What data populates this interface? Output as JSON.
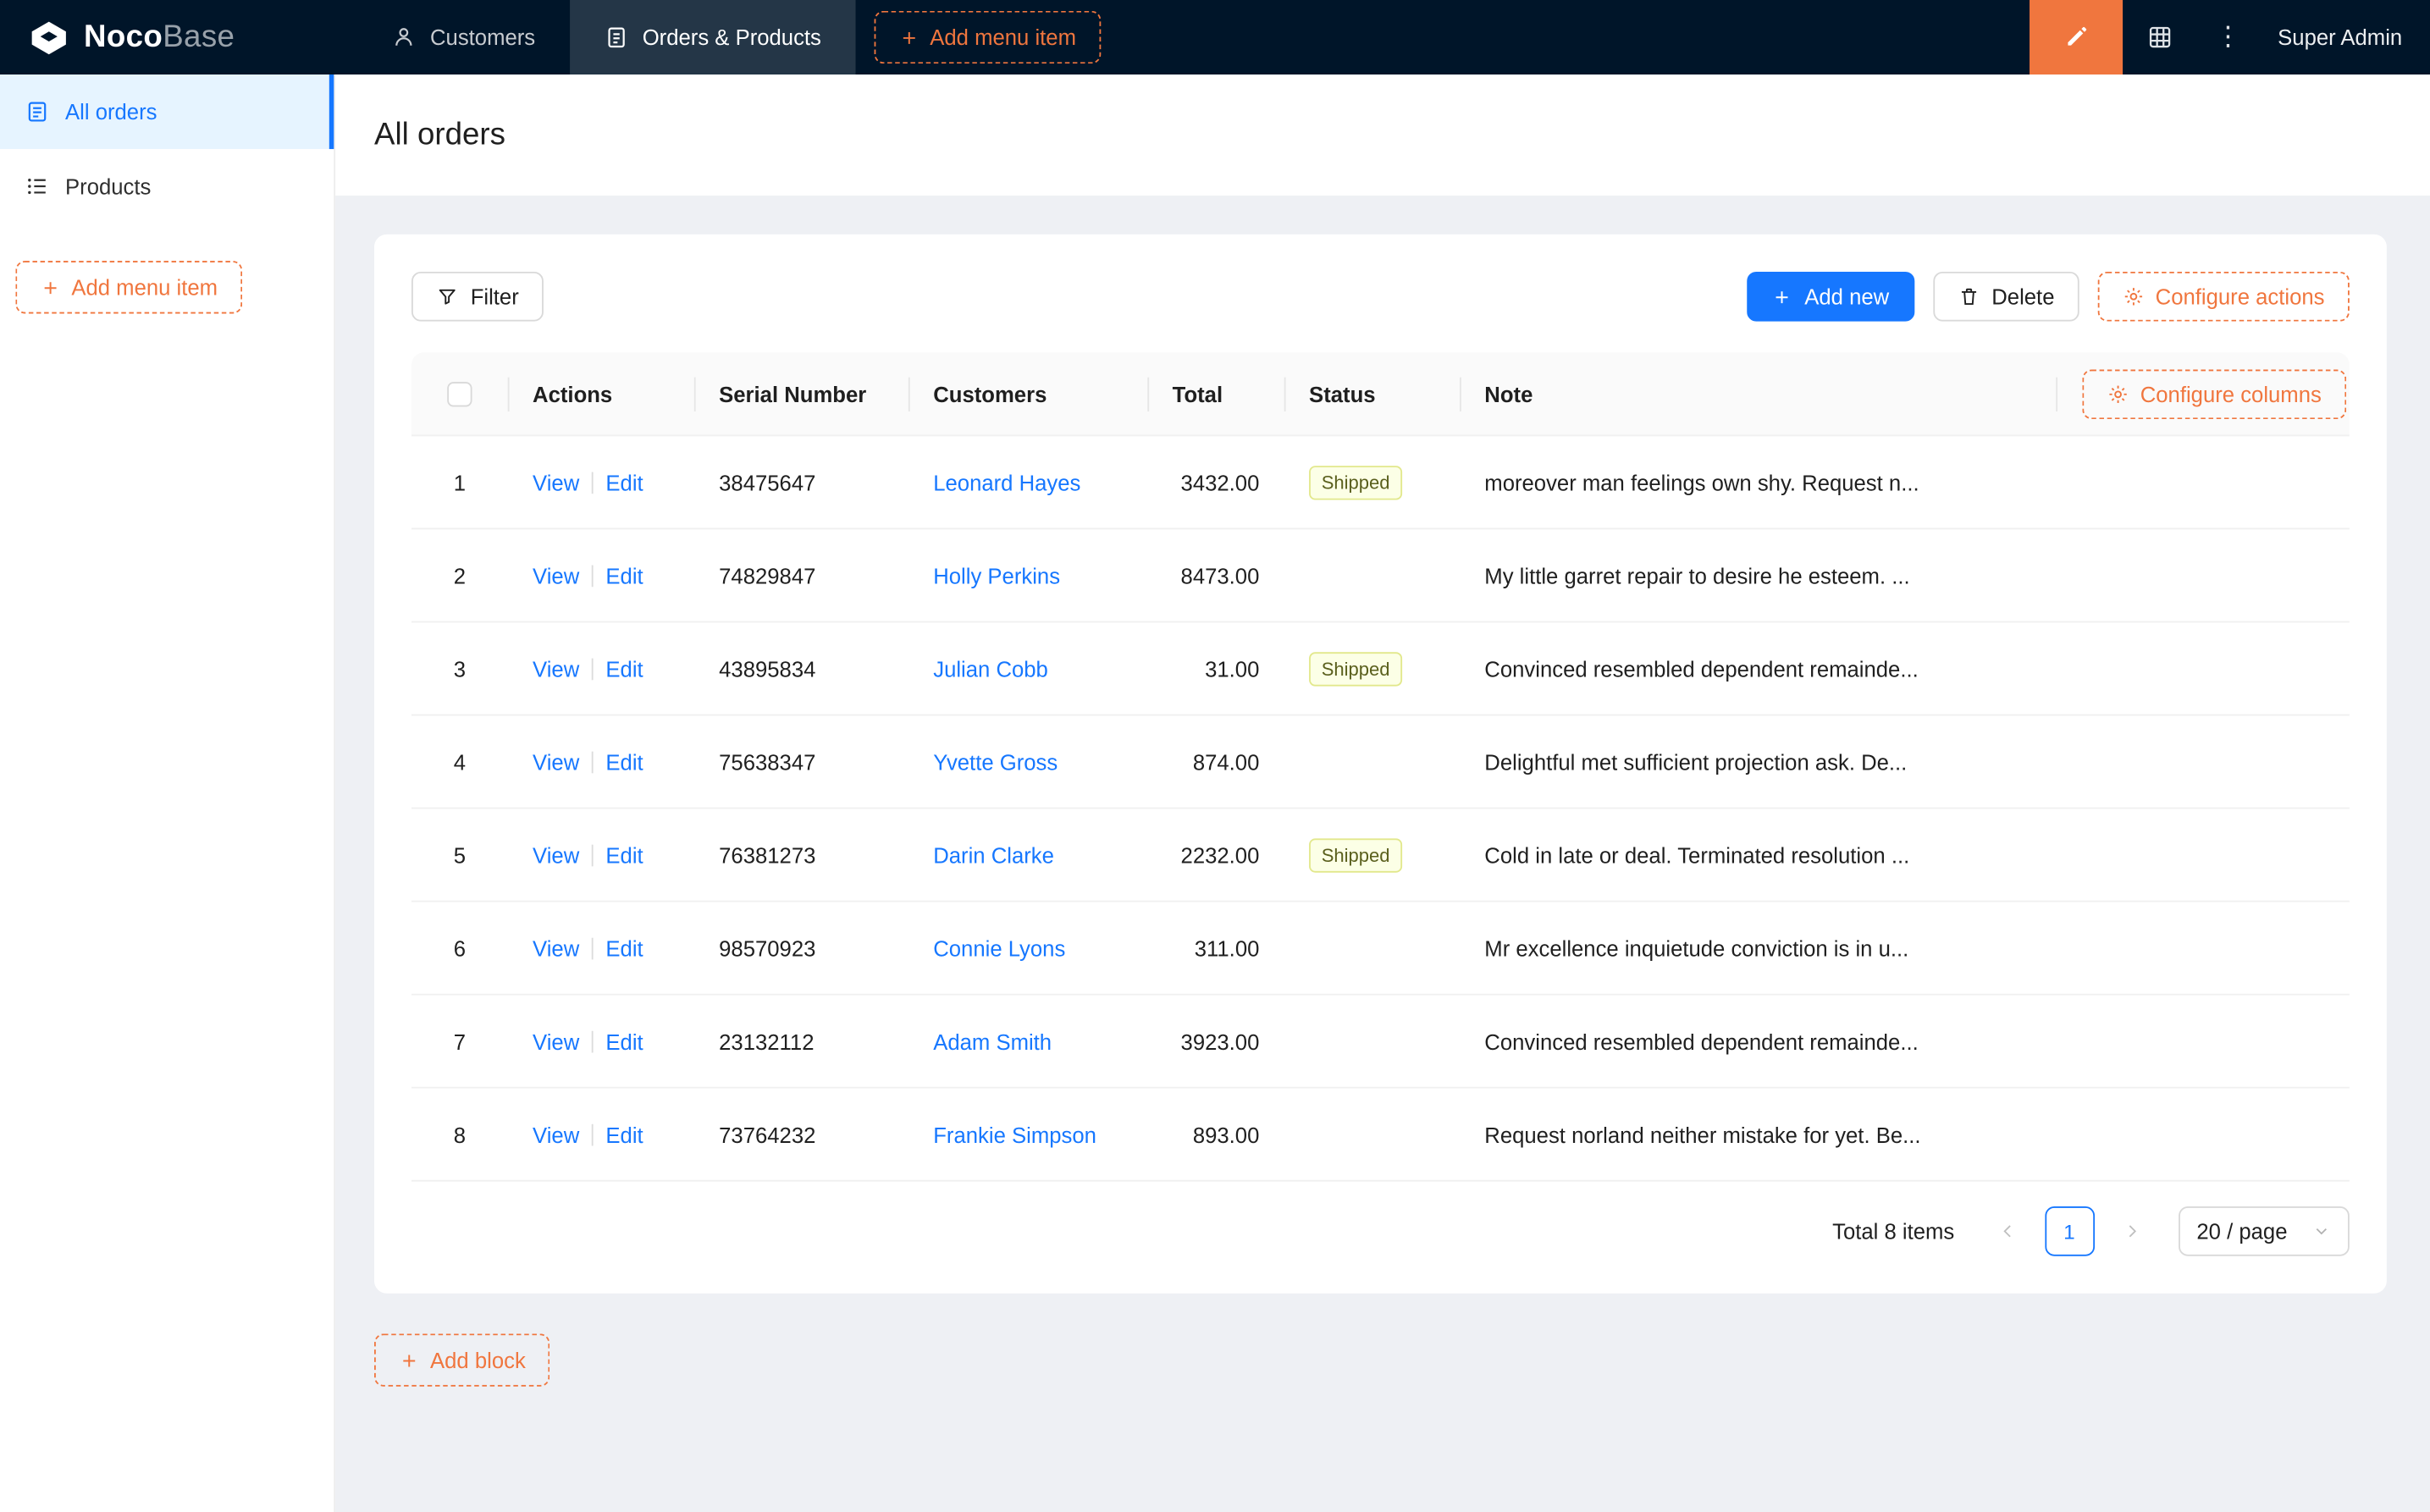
{
  "colors": {
    "header_bg": "#001529",
    "accent_orange": "#F0763E",
    "primary_blue": "#1677FF",
    "link_blue": "#1677FF",
    "content_bg": "#EEF0F4",
    "sidebar_active_bg": "#E6F4FF",
    "status_tag_bg": "#FCFFE6",
    "status_tag_border": "#E2E88C"
  },
  "icons": {
    "logo": "nocobase-logo",
    "customers_tab": "user-icon",
    "orders_tab": "clipboard-icon",
    "add": "plus-icon",
    "ui_editor": "pen-icon",
    "plugins": "grid-icon",
    "more": "kebab-menu-icon",
    "all_orders": "file-list-icon",
    "products": "list-icon",
    "filter": "funnel-icon",
    "delete": "trash-icon",
    "configure": "gear-icon",
    "prev": "chevron-left-icon",
    "next": "chevron-right-icon",
    "page_size": "chevron-down-icon",
    "select_all": "checkbox"
  },
  "header": {
    "logo": {
      "bold": "Noco",
      "light": "Base"
    },
    "nav": [
      {
        "label": "Customers",
        "active": false
      },
      {
        "label": "Orders & Products",
        "active": true
      }
    ],
    "add_menu_item_label": "Add menu item",
    "user_name": "Super Admin"
  },
  "sidebar": {
    "items": [
      {
        "label": "All orders",
        "active": true
      },
      {
        "label": "Products",
        "active": false
      }
    ],
    "add_menu_item_label": "Add menu item"
  },
  "page": {
    "title": "All orders"
  },
  "toolbar": {
    "filter_label": "Filter",
    "add_new_label": "Add new",
    "delete_label": "Delete",
    "configure_actions_label": "Configure actions"
  },
  "table": {
    "configure_columns_label": "Configure columns",
    "columns": [
      "Actions",
      "Serial Number",
      "Customers",
      "Total",
      "Status",
      "Note"
    ],
    "action_labels": {
      "view": "View",
      "edit": "Edit"
    },
    "rows": [
      {
        "index": "1",
        "serial": "38475647",
        "customer": "Leonard Hayes",
        "total": "3432.00",
        "status": "Shipped",
        "note": "moreover man feelings own shy. Request n..."
      },
      {
        "index": "2",
        "serial": "74829847",
        "customer": "Holly Perkins",
        "total": "8473.00",
        "status": "",
        "note": "My little garret repair to desire he esteem. ..."
      },
      {
        "index": "3",
        "serial": "43895834",
        "customer": "Julian Cobb",
        "total": "31.00",
        "status": "Shipped",
        "note": "Convinced resembled dependent remainde..."
      },
      {
        "index": "4",
        "serial": "75638347",
        "customer": "Yvette Gross",
        "total": "874.00",
        "status": "",
        "note": "Delightful met sufficient projection ask. De..."
      },
      {
        "index": "5",
        "serial": "76381273",
        "customer": "Darin Clarke",
        "total": "2232.00",
        "status": "Shipped",
        "note": "Cold in late or deal. Terminated resolution ..."
      },
      {
        "index": "6",
        "serial": "98570923",
        "customer": "Connie Lyons",
        "total": "311.00",
        "status": "",
        "note": "Mr excellence inquietude conviction is in u..."
      },
      {
        "index": "7",
        "serial": "23132112",
        "customer": "Adam Smith",
        "total": "3923.00",
        "status": "",
        "note": "Convinced resembled dependent remainde..."
      },
      {
        "index": "8",
        "serial": "73764232",
        "customer": "Frankie Simpson",
        "total": "893.00",
        "status": "",
        "note": "Request norland neither mistake for yet. Be..."
      }
    ]
  },
  "pagination": {
    "total_label": "Total 8 items",
    "current_page": "1",
    "page_size_label": "20 / page"
  },
  "footer": {
    "add_block_label": "Add block"
  }
}
